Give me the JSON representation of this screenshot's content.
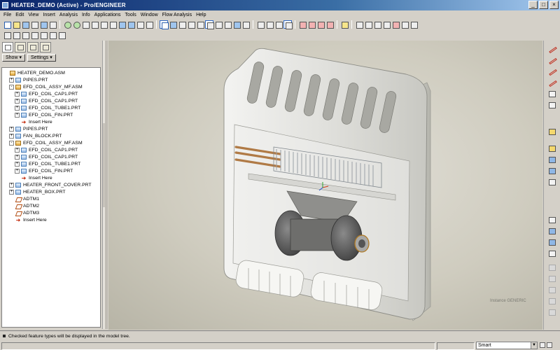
{
  "window": {
    "title": "HEATER_DEMO (Active) - Pro/ENGINEER",
    "min": "_",
    "max": "□",
    "close": "×"
  },
  "menu": [
    "File",
    "Edit",
    "View",
    "Insert",
    "Analysis",
    "Info",
    "Applications",
    "Tools",
    "Window",
    "Flow Analysis",
    "Help"
  ],
  "panel": {
    "show_label": "Show ▾",
    "settings_label": "Settings ▾"
  },
  "tree": [
    {
      "label": "HEATER_DEMO.ASM",
      "level": 0,
      "icon": "asm",
      "expander": ""
    },
    {
      "label": "PIPES.PRT",
      "level": 1,
      "icon": "prt",
      "expander": "+"
    },
    {
      "label": "EFD_COIL_ASSY_MF.ASM",
      "level": 1,
      "icon": "asm",
      "expander": "-"
    },
    {
      "label": "EFD_COIL_CAP1.PRT",
      "level": 2,
      "icon": "prt",
      "expander": "+"
    },
    {
      "label": "EFD_COIL_CAP1.PRT",
      "level": 2,
      "icon": "prt",
      "expander": "+"
    },
    {
      "label": "EFD_COIL_TUBE1.PRT",
      "level": 2,
      "icon": "prt",
      "expander": "+"
    },
    {
      "label": "EFD_COIL_FIN.PRT",
      "level": 2,
      "icon": "prt",
      "expander": "+"
    },
    {
      "label": "Insert Here",
      "level": 2,
      "icon": "ins",
      "expander": ""
    },
    {
      "label": "PIPES.PRT",
      "level": 1,
      "icon": "prt",
      "expander": "+"
    },
    {
      "label": "FAN_BLOCK.PRT",
      "level": 1,
      "icon": "prt",
      "expander": "+"
    },
    {
      "label": "EFD_COIL_ASSY_MF.ASM",
      "level": 1,
      "icon": "asm",
      "expander": "-"
    },
    {
      "label": "EFD_COIL_CAP1.PRT",
      "level": 2,
      "icon": "prt",
      "expander": "+"
    },
    {
      "label": "EFD_COIL_CAP1.PRT",
      "level": 2,
      "icon": "prt",
      "expander": "+"
    },
    {
      "label": "EFD_COIL_TUBE1.PRT",
      "level": 2,
      "icon": "prt",
      "expander": "+"
    },
    {
      "label": "EFD_COIL_FIN.PRT",
      "level": 2,
      "icon": "prt",
      "expander": "+"
    },
    {
      "label": "Insert Here",
      "level": 2,
      "icon": "ins",
      "expander": ""
    },
    {
      "label": "HEATER_FRONT_COVER.PRT",
      "level": 1,
      "icon": "prt",
      "expander": "+"
    },
    {
      "label": "HEATER_BOX.PRT",
      "level": 1,
      "icon": "prt",
      "expander": "+"
    },
    {
      "label": "ADTM1",
      "level": 1,
      "icon": "dtm",
      "expander": ""
    },
    {
      "label": "ADTM2",
      "level": 1,
      "icon": "dtm",
      "expander": ""
    },
    {
      "label": "ADTM3",
      "level": 1,
      "icon": "dtm",
      "expander": ""
    },
    {
      "label": "Insert Here",
      "level": 1,
      "icon": "ins",
      "expander": ""
    }
  ],
  "viewport": {
    "instance_label": "Instance GENERIC"
  },
  "status": {
    "message": "Checked feature types will be displayed in the model tree.",
    "filter": "Smart"
  }
}
